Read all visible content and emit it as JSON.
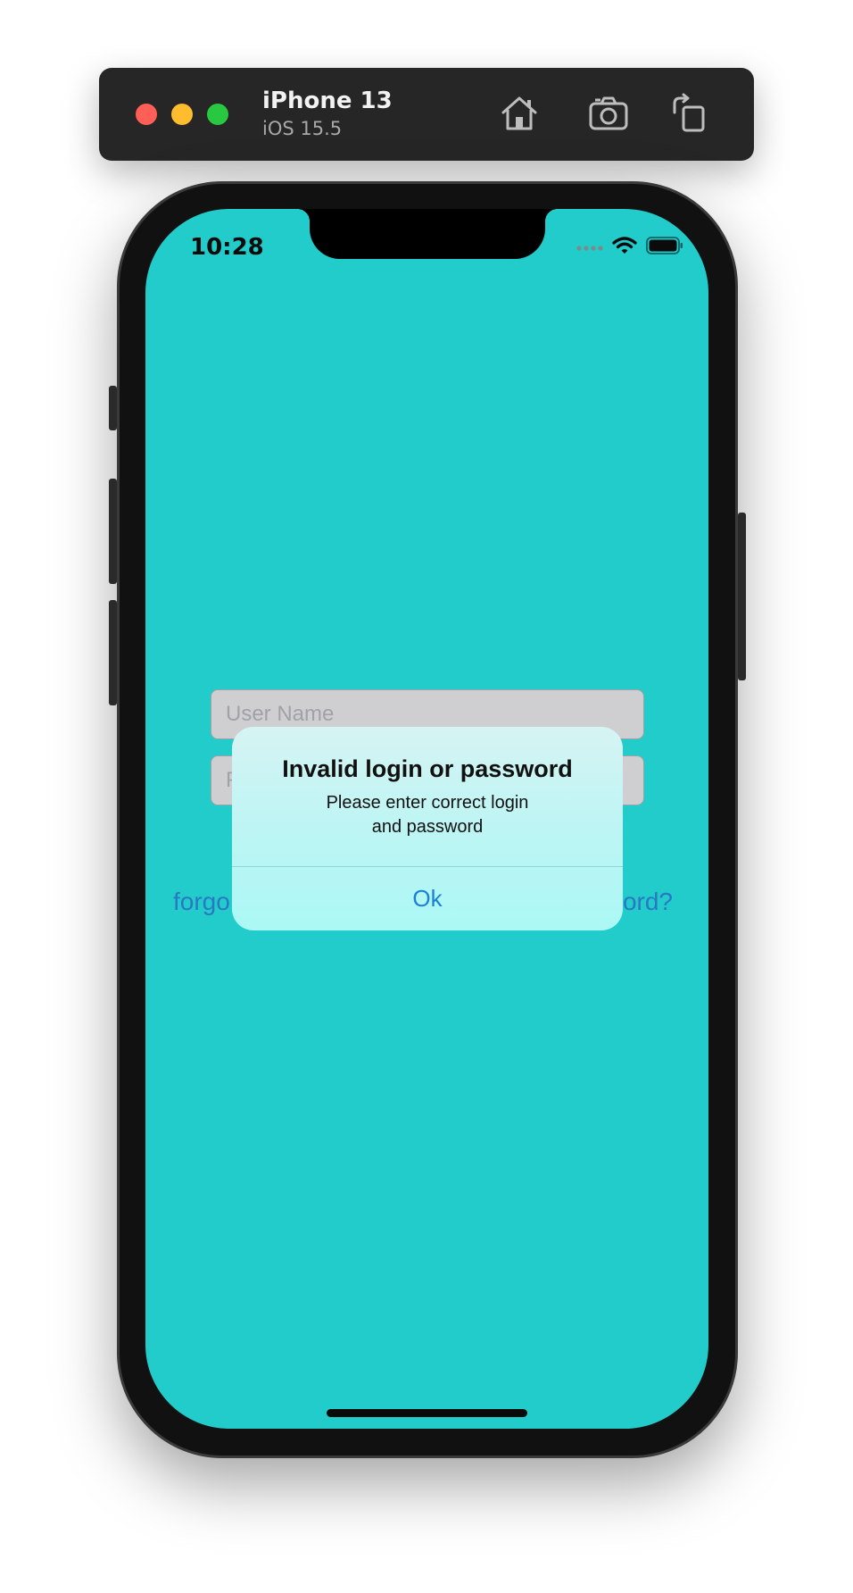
{
  "simulator": {
    "device_name": "iPhone 13",
    "os_version": "iOS 15.5",
    "toolbar_icons": [
      "home-icon",
      "screenshot-icon",
      "rotate-icon"
    ]
  },
  "status_bar": {
    "time": "10:28",
    "icons": [
      "cellular-dots-icon",
      "wifi-icon",
      "battery-icon"
    ]
  },
  "login": {
    "username_placeholder": "User Name",
    "password_placeholder": "P",
    "forgot_link_left": "forgo",
    "forgot_link_right": "ord?"
  },
  "alert": {
    "title": "Invalid login or password",
    "message_line1": "Please enter correct login",
    "message_line2": "and password",
    "ok_label": "Ok"
  },
  "colors": {
    "screen_background": "#21cccb",
    "link": "#2a78c3",
    "alert_button": "#1a7fd6"
  }
}
